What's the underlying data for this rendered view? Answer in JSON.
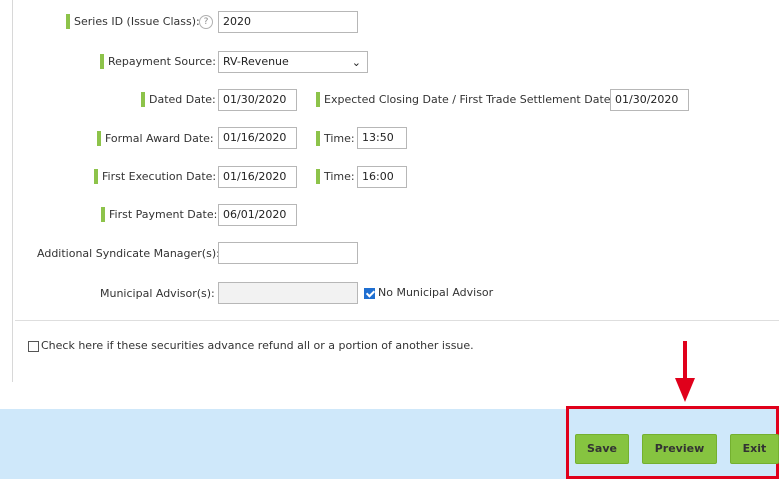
{
  "form": {
    "series_id": {
      "label": "Series ID (Issue Class):",
      "help": "?",
      "value": "2020"
    },
    "repayment_source": {
      "label": "Repayment Source:",
      "value": "RV-Revenue"
    },
    "dated_date": {
      "label": "Dated Date:",
      "value": "01/30/2020"
    },
    "expected_closing": {
      "label": "Expected Closing Date / First Trade Settlement Date:",
      "value": "01/30/2020"
    },
    "formal_award_date": {
      "label": "Formal Award Date:",
      "value": "01/16/2020"
    },
    "formal_award_time": {
      "label": "Time:",
      "value": "13:50"
    },
    "first_execution_date": {
      "label": "First Execution Date:",
      "value": "01/16/2020"
    },
    "first_execution_time": {
      "label": "Time:",
      "value": "16:00"
    },
    "first_payment_date": {
      "label": "First Payment Date:",
      "value": "06/01/2020"
    },
    "additional_syndicate": {
      "label": "Additional Syndicate Manager(s):",
      "value": ""
    },
    "municipal_advisor": {
      "label": "Municipal Advisor(s):",
      "value": ""
    },
    "no_municipal_advisor": {
      "label": "No Municipal Advisor",
      "checked": true
    },
    "advance_refund": {
      "label": "Check here if these securities advance refund all or a portion of another issue.",
      "checked": false
    }
  },
  "footer": {
    "save_label": "Save",
    "preview_label": "Preview",
    "exit_label": "Exit"
  },
  "colors": {
    "required_marker": "#8dc34a",
    "button_green": "#86c440",
    "footer_bg": "#cfe8fa",
    "annotation_red": "#e0001b",
    "checkbox_blue": "#1f6fd1"
  }
}
